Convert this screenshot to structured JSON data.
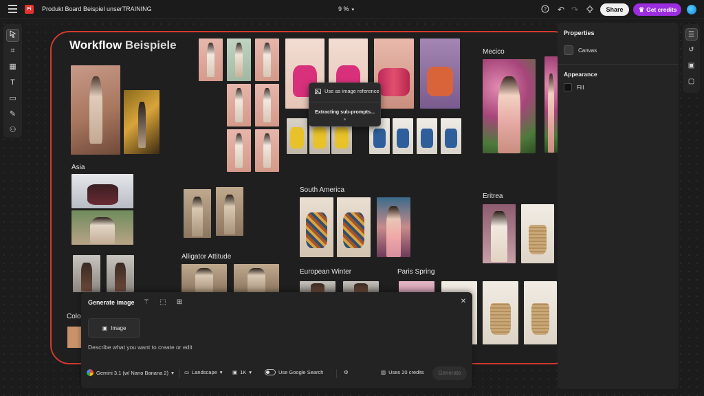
{
  "topbar": {
    "app_logo": "Fi",
    "title": "Produkt Board Beispiel unserTRAINING",
    "zoom": "9 %",
    "share_label": "Share",
    "credits_label": "Get credits",
    "icons": [
      "menu-icon",
      "help-icon",
      "undo-icon",
      "redo-icon",
      "lightbulb-icon",
      "avatar"
    ]
  },
  "board": {
    "title_bold": "Workflow",
    "title_light": "Beispiele",
    "sections": {
      "asia": "Asia",
      "mecico": "Mecico",
      "south_america": "South America",
      "eritrea": "Eritrea",
      "alligator": "Alligator Attitude",
      "european_winter": "European Winter",
      "paris_spring": "Paris Spring",
      "colo": "Colo"
    }
  },
  "popup": {
    "reference_label": "Use as image reference",
    "status": "Extracting sub-prompts..."
  },
  "properties": {
    "title": "Properties",
    "canvas_label": "Canvas",
    "appearance_title": "Appearance",
    "fill_label": "Fill"
  },
  "generate": {
    "title": "Generate image",
    "image_button": "Image",
    "prompt_placeholder": "Describe what you want to create or edit",
    "model": "Gemini 3.1 (w/ Nano Banana 2)",
    "aspect": "Landscape",
    "resolution": "1K",
    "google_search": "Use Google Search",
    "credits": "Uses 20 credits",
    "generate_button": "Generate"
  },
  "colors": {
    "accent": "#9b2de0",
    "board_border": "#d23a2e",
    "swatch": "#c9926a"
  }
}
